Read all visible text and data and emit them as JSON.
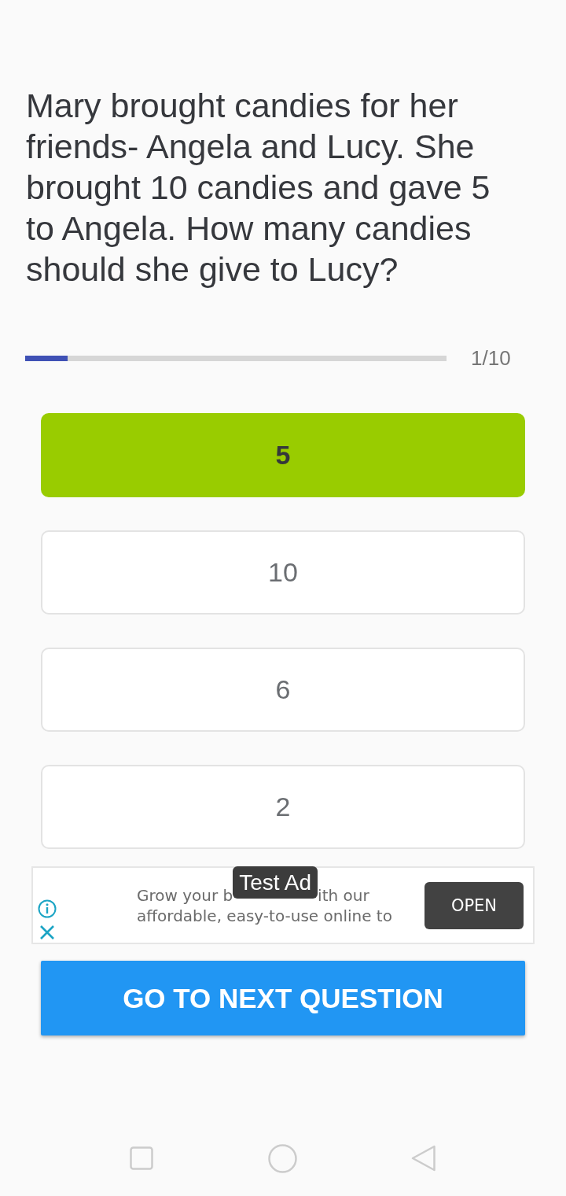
{
  "question": {
    "text": "Mary brought candies for her friends- Angela and Lucy. She brought 10 candies and gave 5 to Angela. How many candies should she give to Lucy?"
  },
  "progress": {
    "level": 0.1,
    "label": "1/10"
  },
  "options": [
    {
      "label": "5",
      "selected": true
    },
    {
      "label": "10",
      "selected": false
    },
    {
      "label": "6",
      "selected": false
    },
    {
      "label": "2",
      "selected": false
    }
  ],
  "ad": {
    "badge": "Test Ad",
    "line_1": [
      "Grow your b",
      "ith our"
    ],
    "line_2": "affordable, easy-to-use online to",
    "button": "OPEN"
  },
  "next_button": {
    "label": "GO TO NEXT QUESTION"
  }
}
